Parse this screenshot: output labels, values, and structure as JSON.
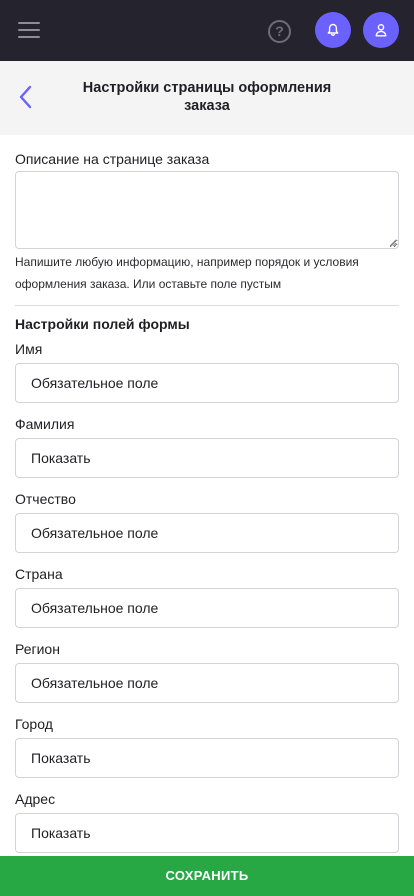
{
  "topbar": {
    "menu_icon": "hamburger-icon",
    "help_icon": "question-circle-icon",
    "help_glyph": "?",
    "notifications_icon": "bell-icon",
    "profile_icon": "user-icon",
    "colors": {
      "background": "#25232d",
      "accent": "#6a61ff"
    }
  },
  "header": {
    "back_icon": "chevron-left-icon",
    "title": "Настройки страницы оформления заказа"
  },
  "description": {
    "label": "Описание на странице заказа",
    "value": "",
    "hint": "Напишите любую информацию, например порядок и условия оформления заказа. Или оставьте поле пустым"
  },
  "form_settings": {
    "title": "Настройки полей формы",
    "fields": [
      {
        "label": "Имя",
        "value": "Обязательное поле"
      },
      {
        "label": "Фамилия",
        "value": "Показать"
      },
      {
        "label": "Отчество",
        "value": "Обязательное поле"
      },
      {
        "label": "Страна",
        "value": "Обязательное поле"
      },
      {
        "label": "Регион",
        "value": "Обязательное поле"
      },
      {
        "label": "Город",
        "value": "Показать"
      },
      {
        "label": "Адрес",
        "value": "Показать"
      }
    ]
  },
  "save": {
    "label": "СОХРАНИТЬ",
    "color": "#28a745"
  }
}
